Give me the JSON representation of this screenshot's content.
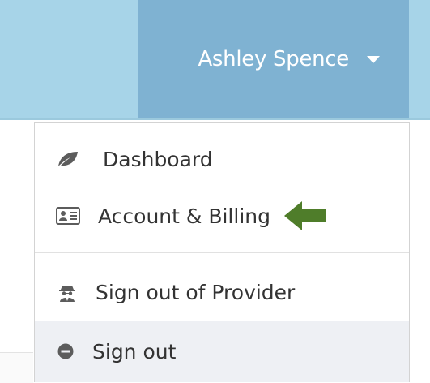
{
  "header": {
    "user_name": "Ashley Spence"
  },
  "dropdown": {
    "items": [
      {
        "label": "Dashboard",
        "icon": "leaf-icon"
      },
      {
        "label": "Account & Billing",
        "icon": "id-card-icon"
      },
      {
        "label": "Sign out of Provider",
        "icon": "user-secret-icon"
      },
      {
        "label": "Sign out",
        "icon": "minus-circle-icon"
      }
    ],
    "highlighted_item": "Sign out"
  },
  "annotation": {
    "icon": "pointer-arrow-icon",
    "color": "#4f7d2a"
  },
  "colors": {
    "topbar": "#a7d4e8",
    "user_menu": "#7fb2d2",
    "menu_text": "#333333",
    "hover_row": "#eef0f4"
  }
}
